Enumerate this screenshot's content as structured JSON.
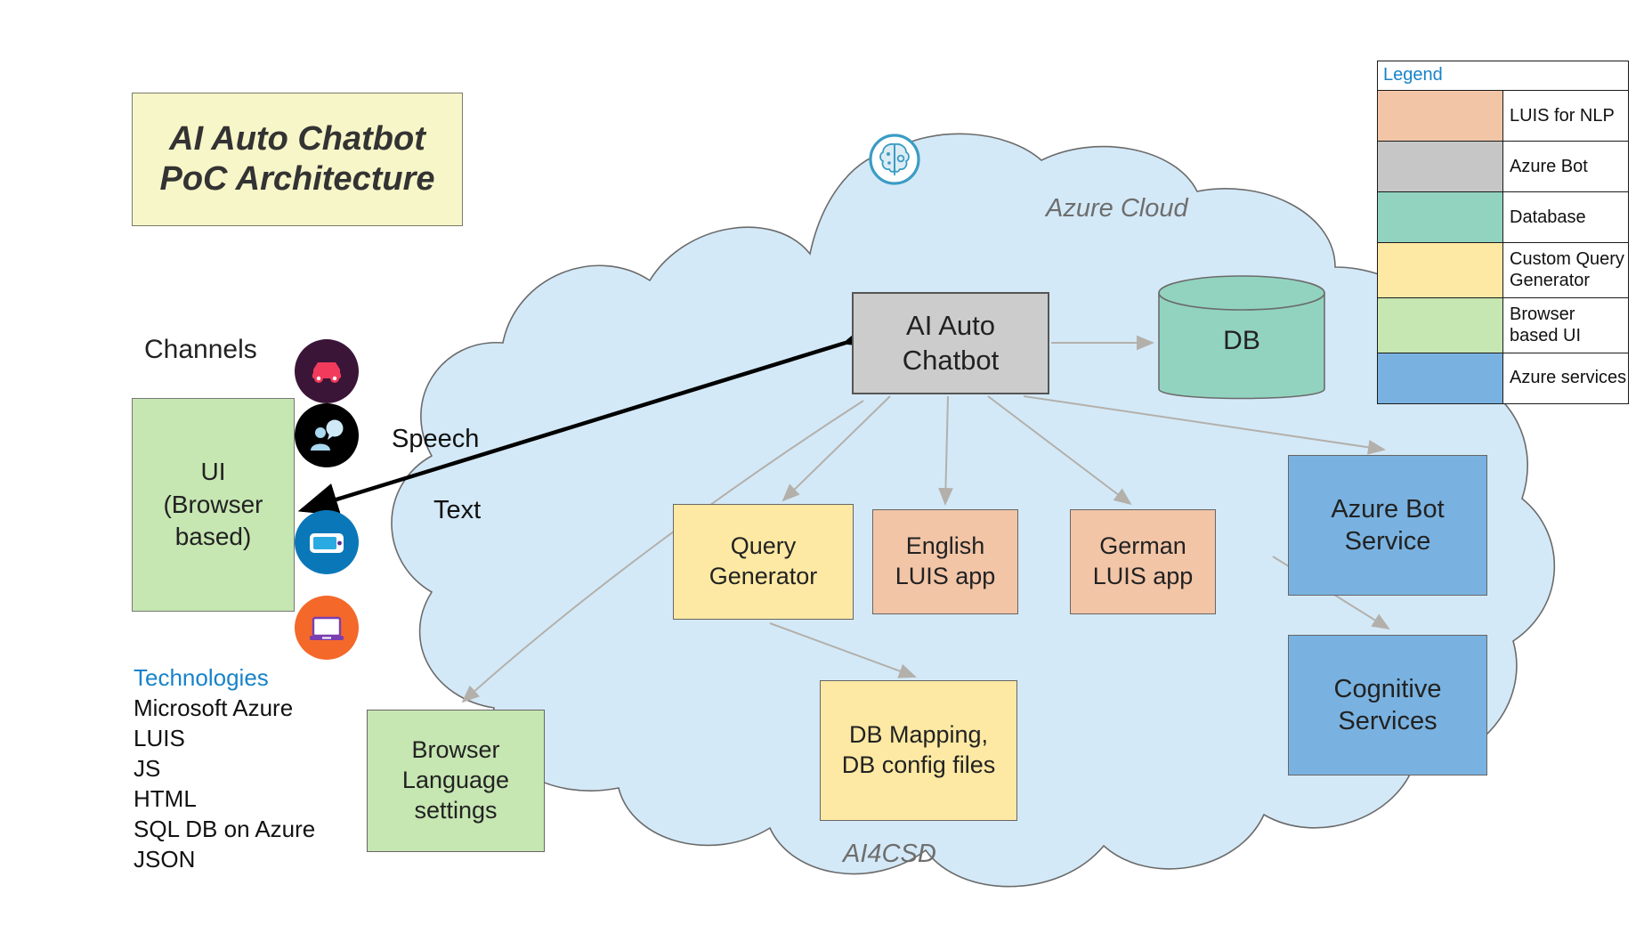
{
  "title_card": {
    "line1": "AI Auto Chatbot",
    "line2": "PoC Architecture",
    "bg": "#f7f6c8"
  },
  "left_panel": {
    "channels_label": "Channels",
    "ui_box": {
      "line1": "UI",
      "line2": "(Browser",
      "line3": "based)",
      "bg": "#c6e6b2"
    },
    "channel_icons": [
      {
        "name": "car-icon",
        "bg": "#3b1538",
        "fg": "#f23a5c"
      },
      {
        "name": "person-speech-icon",
        "bg": "#000000",
        "fg": "#a9d8ef"
      },
      {
        "name": "mobile-device-icon",
        "bg": "#0a78b8",
        "fg": "#29abe2"
      },
      {
        "name": "laptop-icon",
        "bg": "#f4682a",
        "fg": "#7a3fb0"
      }
    ],
    "technologies": {
      "heading": "Technologies",
      "items": [
        "Microsoft Azure",
        "LUIS",
        "JS",
        "HTML",
        "SQL DB on Azure",
        "JSON"
      ]
    }
  },
  "flow_labels": {
    "speech": "Speech",
    "text": "Text"
  },
  "cloud": {
    "name_label": "Azure Cloud",
    "inner_label": "AI4CSD",
    "fill": "#d4e9f7",
    "stroke": "#6b6b6b",
    "brain_icon": "brain-ai-icon"
  },
  "nodes": {
    "chatbot": {
      "line1": "AI Auto",
      "line2": "Chatbot",
      "bg": "#cccccc"
    },
    "db": {
      "label": "DB",
      "bg": "#92d3bf"
    },
    "query_generator": {
      "line1": "Query",
      "line2": "Generator",
      "bg": "#fde9a3"
    },
    "english_luis": {
      "line1": "English",
      "line2": "LUIS app",
      "bg": "#f2c5a7"
    },
    "german_luis": {
      "line1": "German",
      "line2": "LUIS app",
      "bg": "#f2c5a7"
    },
    "browser_language": {
      "line1": "Browser",
      "line2": "Language",
      "line3": "settings",
      "bg": "#c6e6b2"
    },
    "db_mapping": {
      "line1": "DB Mapping,",
      "line2": "DB config files",
      "bg": "#fde9a3"
    },
    "azure_bot_service": {
      "line1": "Azure Bot",
      "line2": "Service",
      "bg": "#79b2e0"
    },
    "cognitive_services": {
      "line1": "Cognitive",
      "line2": "Services",
      "bg": "#79b2e0"
    }
  },
  "legend": {
    "heading": "Legend",
    "rows": [
      {
        "color": "#f2c5a7",
        "label": "LUIS for NLP"
      },
      {
        "color": "#c6c6c6",
        "label": "Azure Bot"
      },
      {
        "color": "#92d3bf",
        "label": "Database"
      },
      {
        "color": "#fde9a3",
        "label": "Custom Query Generator"
      },
      {
        "color": "#c6e6b2",
        "label": "Browser based UI"
      },
      {
        "color": "#79b2e0",
        "label": "Azure services"
      }
    ]
  }
}
